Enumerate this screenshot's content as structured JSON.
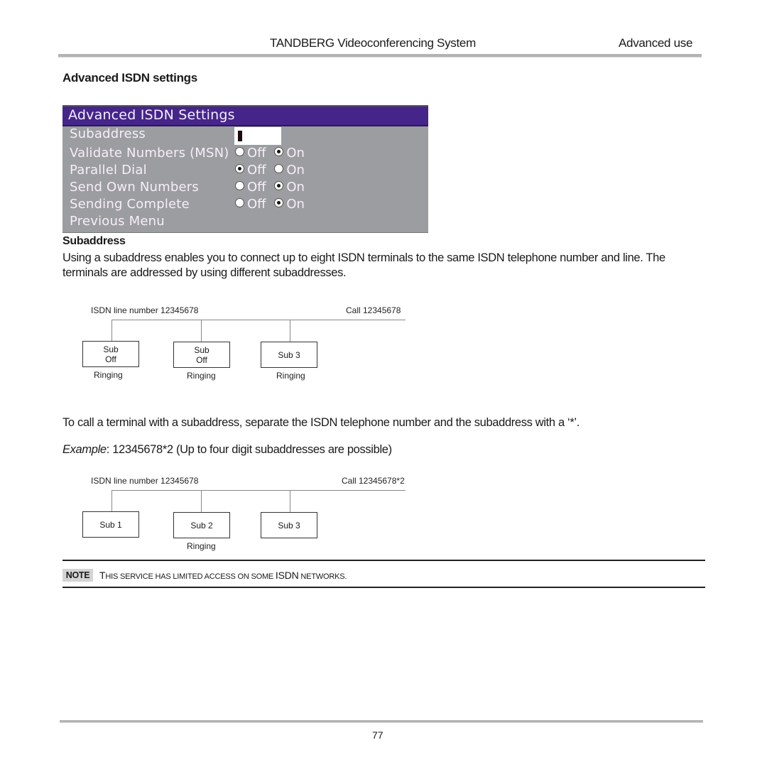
{
  "header": {
    "title": "TANDBERG Videoconferencing System",
    "section": "Advanced use"
  },
  "section_title": "Advanced ISDN settings",
  "osd_menu": {
    "title": "Advanced ISDN Settings",
    "colors": {
      "title_bar": "#46258a",
      "body": "#9c9da0",
      "text": "#f6eefb"
    },
    "subaddress": {
      "label": "Subaddress",
      "value": ""
    },
    "options": [
      {
        "label": "Validate Numbers (MSN)",
        "off_label": "Off",
        "on_label": "On",
        "selected": "On"
      },
      {
        "label": "Parallel Dial",
        "off_label": "Off",
        "on_label": "On",
        "selected": "Off"
      },
      {
        "label": "Send Own Numbers",
        "off_label": "Off",
        "on_label": "On",
        "selected": "On"
      },
      {
        "label": "Sending Complete",
        "off_label": "Off",
        "on_label": "On",
        "selected": "On"
      }
    ],
    "previous_menu": "Previous Menu"
  },
  "subaddress_section": {
    "title": "Subaddress",
    "paragraph": "Using a subaddress enables you to connect up to eight ISDN terminals to the same ISDN telephone number and line. The terminals are addressed by using different subaddresses."
  },
  "diagram1": {
    "line_label": "ISDN line number 12345678",
    "call_label": "Call 12345678",
    "boxes": [
      {
        "line1": "Sub",
        "line2": "Off",
        "status": "Ringing"
      },
      {
        "line1": "Sub",
        "line2": "Off",
        "status": "Ringing"
      },
      {
        "line1": "Sub 3",
        "line2": "",
        "status": "Ringing"
      }
    ]
  },
  "call_paragraph": "To call a terminal with a subaddress, separate the ISDN telephone number and the subaddress with a ‘*’.",
  "example": {
    "label": "Example",
    "text": ":  12345678*2 (Up to four digit subaddresses are possible)"
  },
  "diagram2": {
    "line_label": "ISDN line number 12345678",
    "call_label": "Call 12345678*2",
    "boxes": [
      {
        "line1": "Sub 1",
        "line2": "",
        "status": ""
      },
      {
        "line1": "Sub 2",
        "line2": "",
        "status": "Ringing"
      },
      {
        "line1": "Sub 3",
        "line2": "",
        "status": ""
      }
    ]
  },
  "note": {
    "badge": "NOTE",
    "text_parts": [
      "T",
      "HIS SERVICE HAS LIMITED ACCESS ON SOME ",
      "ISDN",
      " NETWORKS."
    ]
  },
  "footer": {
    "page_number": "77"
  }
}
